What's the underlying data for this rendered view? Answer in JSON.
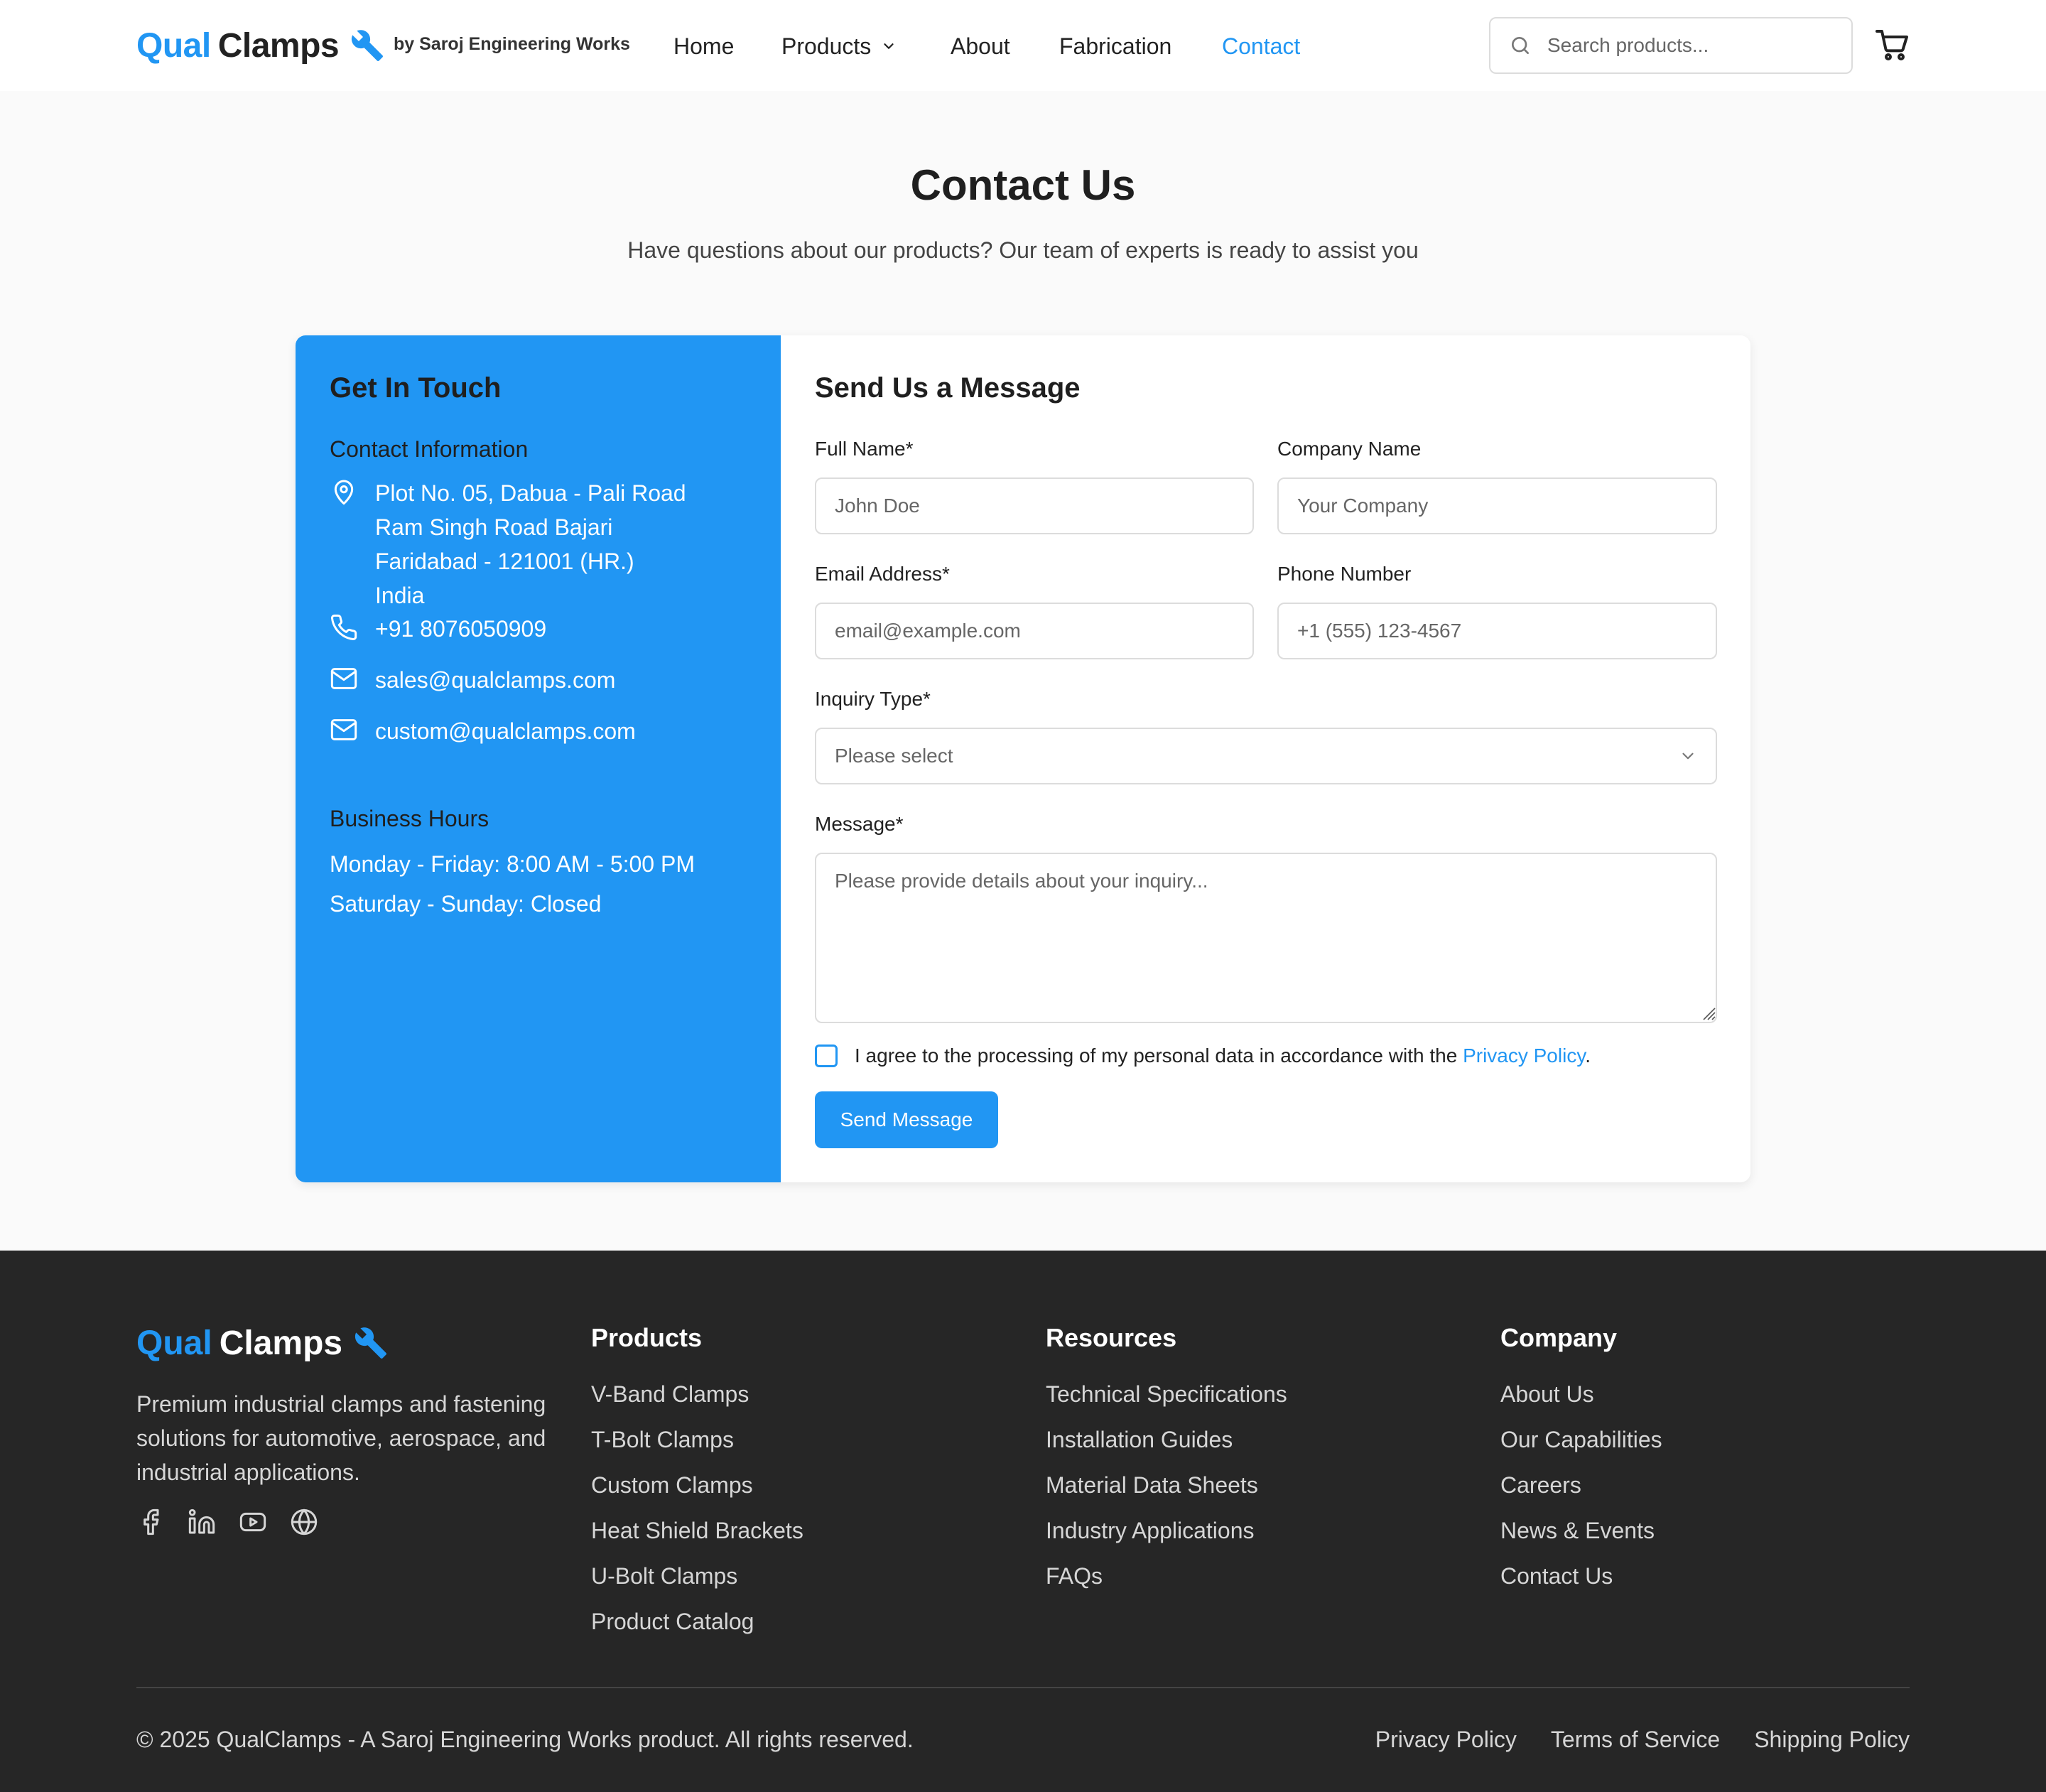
{
  "brand": {
    "name_part1": "Qual",
    "name_part2": "Clamps",
    "byline": "by Saroj Engineering Works",
    "accent_color": "#2196f3",
    "icon": "wrench-icon"
  },
  "nav": {
    "items": [
      {
        "label": "Home",
        "active": false
      },
      {
        "label": "Products",
        "active": false,
        "dropdown": true
      },
      {
        "label": "About",
        "active": false
      },
      {
        "label": "Fabrication",
        "active": false
      },
      {
        "label": "Contact",
        "active": true
      }
    ]
  },
  "search": {
    "placeholder": "Search products...",
    "icon": "search-icon"
  },
  "cart": {
    "icon": "cart-icon"
  },
  "hero": {
    "title": "Contact Us",
    "subtitle": "Have questions about our products? Our team of experts is ready to assist you"
  },
  "contact_info": {
    "heading": "Get In Touch",
    "section_title": "Contact Information",
    "address_lines": [
      "Plot No. 05, Dabua - Pali Road",
      "Ram Singh Road Bajari",
      "Faridabad - 121001 (HR.)",
      "India"
    ],
    "phone": "+91 8076050909",
    "emails": [
      "sales@qualclamps.com",
      "custom@qualclamps.com"
    ],
    "hours_title": "Business Hours",
    "hours": [
      "Monday - Friday: 8:00 AM - 5:00 PM",
      "Saturday - Sunday: Closed"
    ],
    "panel_color": "#2196f3"
  },
  "form": {
    "heading": "Send Us a Message",
    "full_name": {
      "label": "Full Name*",
      "placeholder": "John Doe",
      "value": ""
    },
    "company": {
      "label": "Company Name",
      "placeholder": "Your Company",
      "value": ""
    },
    "email": {
      "label": "Email Address*",
      "placeholder": "email@example.com",
      "value": ""
    },
    "phone": {
      "label": "Phone Number",
      "placeholder": "+1 (555) 123-4567",
      "value": ""
    },
    "inquiry": {
      "label": "Inquiry Type*",
      "selected": "Please select"
    },
    "message": {
      "label": "Message*",
      "placeholder": "Please provide details about your inquiry...",
      "value": ""
    },
    "consent": {
      "text": "I agree to the processing of my personal data in accordance with the",
      "link": "Privacy Policy",
      "checked": false
    },
    "submit_label": "Send Message"
  },
  "footer": {
    "description": "Premium industrial clamps and fastening solutions for automotive, aerospace, and industrial applications.",
    "social_icons": [
      "facebook-icon",
      "linkedin-icon",
      "youtube-icon",
      "globe-icon"
    ],
    "columns": [
      {
        "title": "Products",
        "links": [
          "V-Band Clamps",
          "T-Bolt Clamps",
          "Custom Clamps",
          "Heat Shield Brackets",
          "U-Bolt Clamps",
          "Product Catalog"
        ]
      },
      {
        "title": "Resources",
        "links": [
          "Technical Specifications",
          "Installation Guides",
          "Material Data Sheets",
          "Industry Applications",
          "FAQs"
        ]
      },
      {
        "title": "Company",
        "links": [
          "About Us",
          "Our Capabilities",
          "Careers",
          "News & Events",
          "Contact Us"
        ]
      }
    ],
    "copyright": "© 2025 QualClamps - A Saroj Engineering Works product. All rights reserved.",
    "legal_links": [
      "Privacy Policy",
      "Terms of Service",
      "Shipping Policy"
    ],
    "background": "#262626"
  }
}
